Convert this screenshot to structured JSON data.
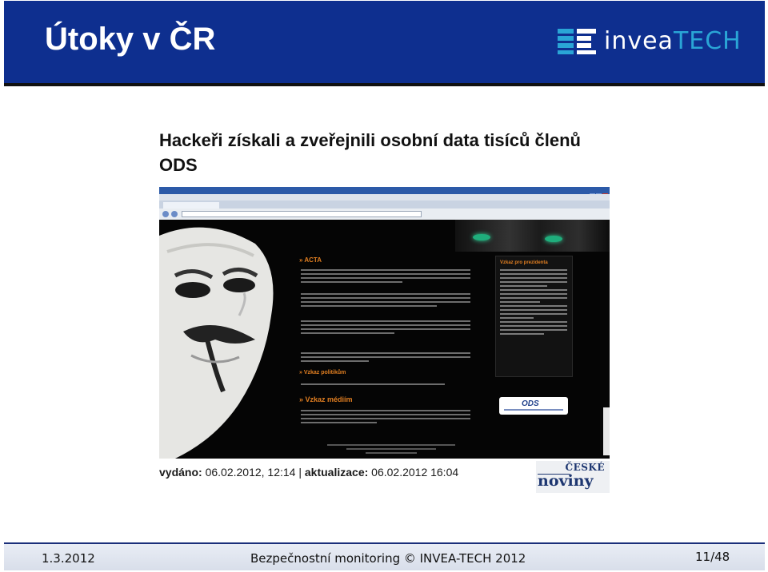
{
  "slide": {
    "title": "Útoky v ČR",
    "logo": {
      "text_main": "invea",
      "text_accent": "TECH"
    }
  },
  "article": {
    "headline": "Hackeři získali a zveřejnili osobní data tisíců členů ODS",
    "published_label": "vydáno:",
    "published_value": "06.02.2012, 12:14",
    "separator": "|",
    "updated_label": "aktualizace:",
    "updated_value": "06.02.2012 16:04",
    "source_logo": {
      "top": "ČESKÉ",
      "bottom": "noviny"
    }
  },
  "screenshot": {
    "sections": [
      "» ACTA",
      "» Vzkaz politikům",
      "» Vzkaz médiím"
    ],
    "sidebar_heading": "Vzkaz pro prezidenta",
    "banner_text": "ODS"
  },
  "footer": {
    "date": "1.3.2012",
    "center": "Bezpečnostní monitoring © INVEA-TECH 2012",
    "page": "11/48"
  },
  "colors": {
    "header_bg": "#0e2f8f",
    "accent": "#2aa5d6",
    "screenshot_section": "#e07e21"
  }
}
